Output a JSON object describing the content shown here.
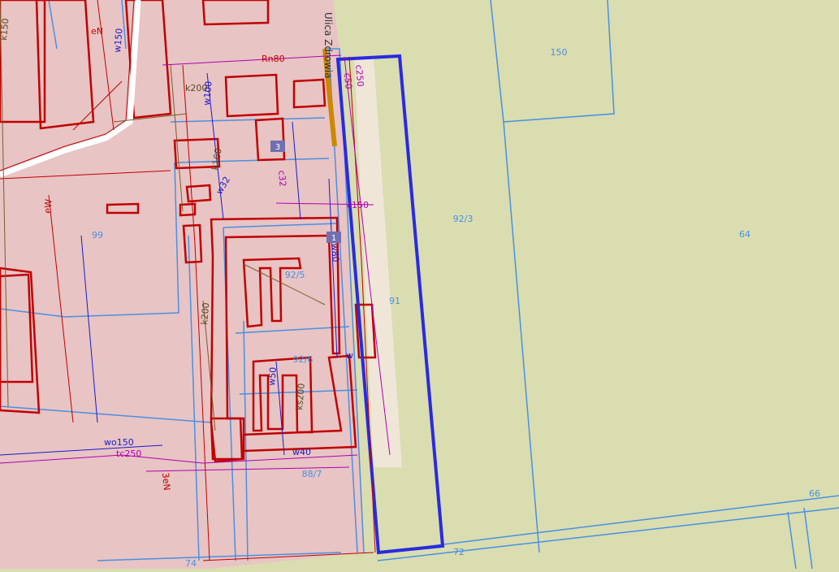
{
  "map": {
    "background_color": "#d9ddb0",
    "built_area_color": "#e8c4c4",
    "colors": {
      "building_outline": "#c00000",
      "parcel_line": "#4a90e2",
      "selected_parcel": "#2a2ae0",
      "electric_line": "#c00000",
      "sewer_line": "#7a5c2e",
      "gas_line": "#b000b0",
      "water_line": "#1a1ac8",
      "heating_line": "#e89a00",
      "road_fill": "#ffffff",
      "map_number": "#4a90e2",
      "building_badge": "#7070b0"
    },
    "street_name": "Ulica Zdrowia",
    "parcel_numbers": [
      {
        "id": "p150",
        "text": "150"
      },
      {
        "id": "p923",
        "text": "92/3"
      },
      {
        "id": "p64",
        "text": "64"
      },
      {
        "id": "p99",
        "text": "99"
      },
      {
        "id": "p91",
        "text": "91"
      },
      {
        "id": "p925",
        "text": "92/5"
      },
      {
        "id": "p926",
        "text": "92/6"
      },
      {
        "id": "p887",
        "text": "88/7"
      },
      {
        "id": "p74",
        "text": "74"
      },
      {
        "id": "p72",
        "text": "72"
      },
      {
        "id": "p66",
        "text": "66"
      }
    ],
    "building_numbers": [
      "3",
      "1"
    ],
    "utility_labels": [
      {
        "text": "k150"
      },
      {
        "text": "eN"
      },
      {
        "text": "w150"
      },
      {
        "text": "k200"
      },
      {
        "text": "w100"
      },
      {
        "text": "w32"
      },
      {
        "text": "k160"
      },
      {
        "text": "c50"
      },
      {
        "text": "c250"
      },
      {
        "text": "c150"
      },
      {
        "text": "w80"
      },
      {
        "text": "c32"
      },
      {
        "text": "k200"
      },
      {
        "text": "ks200"
      },
      {
        "text": "w50"
      },
      {
        "text": "w40"
      },
      {
        "text": "wo150"
      },
      {
        "text": "tc250"
      },
      {
        "text": "Rn80"
      },
      {
        "text": "eW"
      },
      {
        "text": "w"
      },
      {
        "text": "3eN"
      }
    ]
  }
}
